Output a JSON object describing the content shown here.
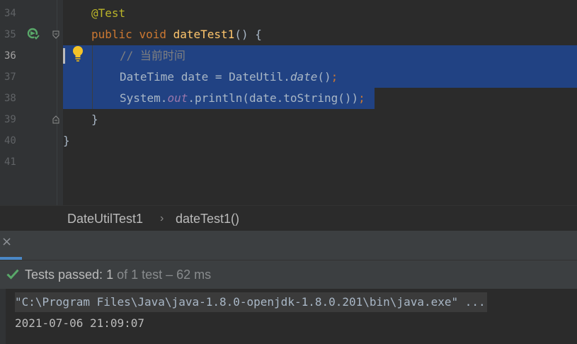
{
  "editor": {
    "lines": [
      {
        "number": "34",
        "code": "@Test"
      },
      {
        "number": "35",
        "code_kw1": "public",
        "code_kw2": "void",
        "code_fn": "dateTest1",
        "code_rest": "() {"
      },
      {
        "number": "36",
        "code": "// 当前时间"
      },
      {
        "number": "37",
        "code_a": "DateTime date = DateUtil.",
        "code_it": "date",
        "code_b": "()",
        "code_semi": ";"
      },
      {
        "number": "38",
        "code_a": "System.",
        "code_fld": "out",
        "code_b": ".println(date.toString())",
        "code_semi": ";"
      },
      {
        "number": "39",
        "code": "}"
      },
      {
        "number": "40",
        "code": "}"
      },
      {
        "number": "41",
        "code": ""
      }
    ]
  },
  "breadcrumb": {
    "class_name": "DateUtilTest1",
    "separator": "›",
    "method_name": "dateTest1()"
  },
  "tab": {
    "close_glyph": "×"
  },
  "status": {
    "label": "Tests passed: ",
    "passed": "1",
    "detail": " of 1 test – 62 ms"
  },
  "console": {
    "command": "\"C:\\Program Files\\Java\\java-1.8.0-openjdk-1.8.0.201\\bin\\java.exe\" ...",
    "output": "2021-07-06 21:09:07"
  },
  "colors": {
    "selection": "#214283",
    "keyword": "#cc7832",
    "function": "#ffc66d",
    "annotation": "#bbb529",
    "success": "#59a869"
  }
}
